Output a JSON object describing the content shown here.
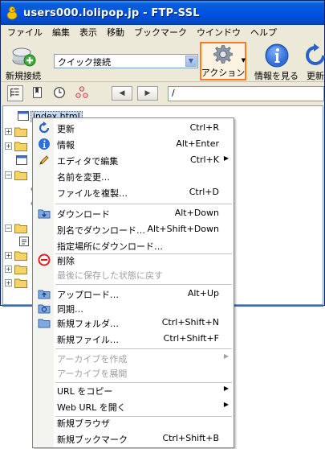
{
  "window": {
    "title": "users000.lolipop.jp - FTP-SSL"
  },
  "menubar": {
    "items": [
      "ファイル",
      "編集",
      "表示",
      "移動",
      "ブックマーク",
      "ウインドウ",
      "ヘルプ"
    ]
  },
  "toolbar": {
    "new_connection": "新規接続",
    "quick_connect": "クイック接続",
    "action": "アクション",
    "info": "情報を見る",
    "update": "更新"
  },
  "toolbar2": {
    "path": "/"
  },
  "tree": {
    "selected_file": "index.html"
  },
  "context_menu": {
    "items": [
      {
        "label": "更新",
        "shortcut": "Ctrl+R",
        "icon": "refresh-icon",
        "disabled": false,
        "submenu": false
      },
      {
        "label": "情報",
        "shortcut": "Alt+Enter",
        "icon": "info-icon",
        "disabled": false,
        "submenu": false
      },
      {
        "label": "エディタで編集",
        "shortcut": "Ctrl+K",
        "icon": "pencil-icon",
        "disabled": false,
        "submenu": true
      },
      {
        "label": "名前を変更…",
        "shortcut": "",
        "icon": "",
        "disabled": false,
        "submenu": false
      },
      {
        "label": "ファイルを複製…",
        "shortcut": "Ctrl+D",
        "icon": "",
        "disabled": false,
        "submenu": false
      },
      {
        "label": "ダウンロード",
        "shortcut": "Alt+Down",
        "icon": "download-folder-icon",
        "disabled": false,
        "submenu": false
      },
      {
        "label": "別名でダウンロード…",
        "shortcut": "Alt+Shift+Down",
        "icon": "",
        "disabled": false,
        "submenu": false
      },
      {
        "label": "指定場所にダウンロード…",
        "shortcut": "",
        "icon": "",
        "disabled": false,
        "submenu": false
      },
      {
        "label": "削除",
        "shortcut": "",
        "icon": "delete-icon",
        "disabled": false,
        "submenu": false
      },
      {
        "label": "最後に保存した状態に戻す",
        "shortcut": "",
        "icon": "",
        "disabled": true,
        "submenu": false
      },
      {
        "label": "アップロード…",
        "shortcut": "Alt+Up",
        "icon": "upload-folder-icon",
        "disabled": false,
        "submenu": false
      },
      {
        "label": "同期…",
        "shortcut": "",
        "icon": "sync-folder-icon",
        "disabled": false,
        "submenu": false
      },
      {
        "label": "新規フォルダ…",
        "shortcut": "Ctrl+Shift+N",
        "icon": "new-folder-icon",
        "disabled": false,
        "submenu": false
      },
      {
        "label": "新規ファイル…",
        "shortcut": "Ctrl+Shift+F",
        "icon": "",
        "disabled": false,
        "submenu": false
      },
      {
        "label": "アーカイブを作成",
        "shortcut": "",
        "icon": "",
        "disabled": true,
        "submenu": true
      },
      {
        "label": "アーカイブを展開",
        "shortcut": "",
        "icon": "",
        "disabled": true,
        "submenu": false
      },
      {
        "label": "URL をコピー",
        "shortcut": "",
        "icon": "",
        "disabled": false,
        "submenu": true
      },
      {
        "label": "Web URL を開く",
        "shortcut": "",
        "icon": "",
        "disabled": false,
        "submenu": true
      },
      {
        "label": "新規ブラウザ",
        "shortcut": "",
        "icon": "",
        "disabled": false,
        "submenu": false
      },
      {
        "label": "新規ブックマーク",
        "shortcut": "Ctrl+Shift+B",
        "icon": "",
        "disabled": false,
        "submenu": false
      }
    ]
  },
  "colors": {
    "title_bar": "#0054e3",
    "action_highlight": "#ff7a1a",
    "selection": "#c5d9f1"
  }
}
